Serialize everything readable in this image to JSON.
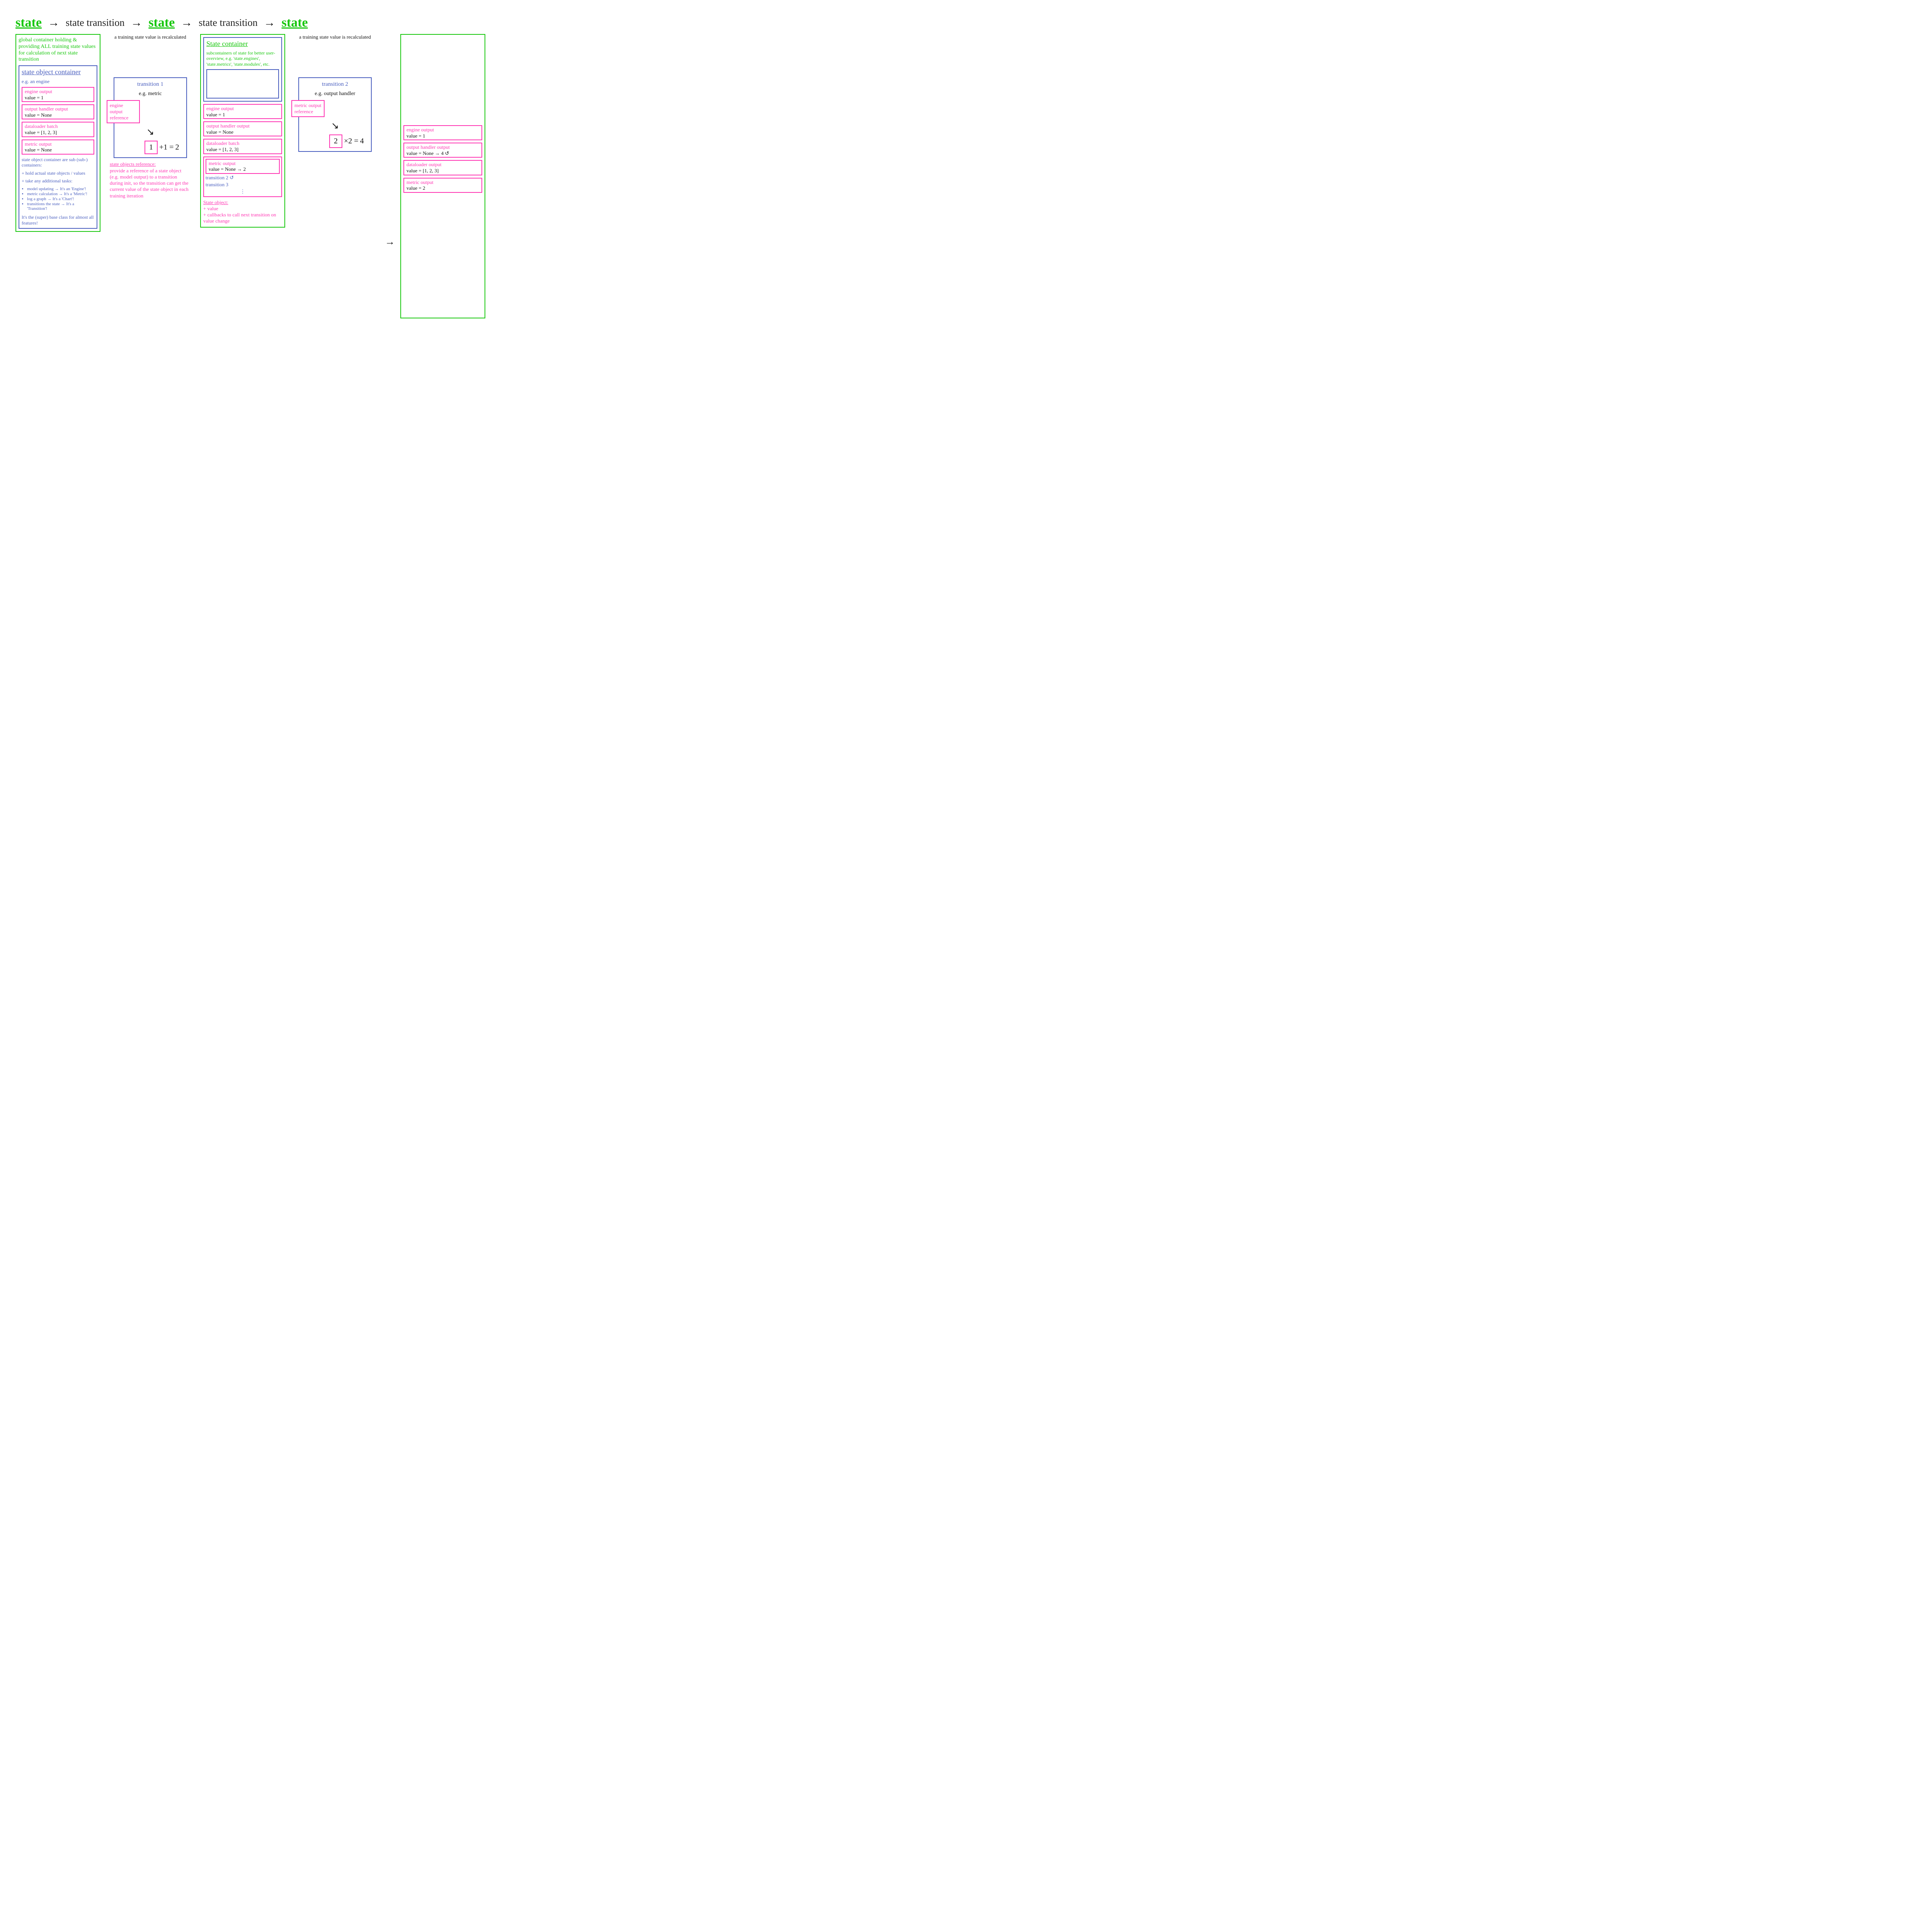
{
  "header": {
    "state1": "state",
    "arrow": "→",
    "trans1": "state transition",
    "state2": "state",
    "trans2": "state transition",
    "state3": "state"
  },
  "trans_note": "a training state value is recalculated",
  "col1": {
    "intro": "global container holding & providing ALL training state values for calculation of next state transition",
    "soc_title": "state object container",
    "soc_sub": "e.g. an engine",
    "engine_label": "engine output",
    "engine_val": "value = 1",
    "oh_label": "output handler output",
    "oh_val": "value = None",
    "dl_label": "dataloader batch",
    "dl_val": "value = [1, 2, 3]",
    "metric_label": "metric output",
    "metric_val": "value = None",
    "notes1": "state object container are sub (sub-) containers:",
    "notes2": "+ hold actual state objects / values",
    "notes3": "+ take any additional tasks:",
    "li1": "model updating → It's an 'Engine'!",
    "li2": "metric calculation → It's a 'Metric'!",
    "li3": "log a graph → It's a 'Chart'!",
    "li4": "transitions the state → It's a 'Transition'!",
    "notes4": "It's the (super) base class for almost all features!"
  },
  "t1": {
    "title": "transition 1",
    "sub": "e.g. metric",
    "ref": "engine output reference",
    "val_in": "1",
    "op": "+1 =",
    "val_out": "2",
    "ref_title": "state objects reference:",
    "ref_body": "provide a reference of a state object (e.g. model output) to a transition during init, so the transition can get the current value of the state object in each training iteration"
  },
  "col2": {
    "sc_title": "State container",
    "sc_body": "subcontainers of state for better user-overview, e.g. 'state.engines', 'state.metrics', 'state.modules', etc.",
    "engine_label": "engine output",
    "engine_val": "value = 1",
    "oh_label": "output handler output",
    "oh_val": "value = None",
    "dl_label": "dataloader batch",
    "dl_val": "value = [1, 2, 3]",
    "metric_label": "metric output",
    "metric_val": "value = None → 2",
    "t2line": "transition 2  ↺",
    "t3line": "transition 3",
    "dots": "⋮",
    "so_title": "State object:",
    "so_body": "+ value\n+ callbacks to call next transition on value change"
  },
  "t2": {
    "title": "transition 2",
    "sub": "e.g. output handler",
    "ref": "metric output reference",
    "val_in": "2",
    "op": "×2 =",
    "val_out": "4"
  },
  "col3": {
    "engine_label": "engine output",
    "engine_val": "value = 1",
    "oh_label": "output handler output",
    "oh_val": "value = None → 4 ↺",
    "dl_label": "dataloader output",
    "dl_val": "value = [1, 2, 3]",
    "metric_label": "metric output",
    "metric_val": "value = 2"
  }
}
